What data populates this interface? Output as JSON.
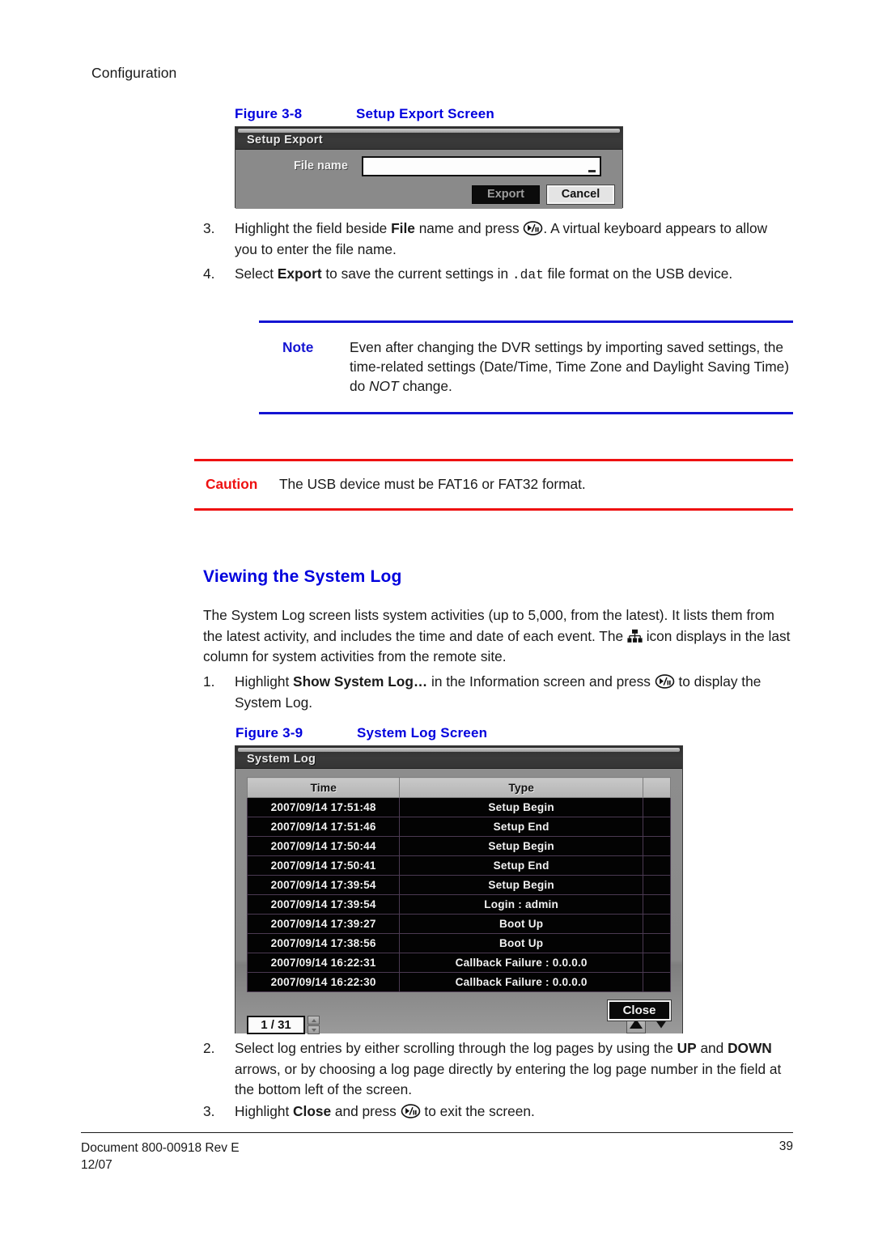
{
  "header": {
    "running_head": "Configuration"
  },
  "footer": {
    "document": "Document 800-00918 Rev E",
    "date": "12/07",
    "page_number": "39"
  },
  "figure_3_8": {
    "number": "Figure 3-8",
    "title": "Setup Export Screen",
    "dialog": {
      "titlebar": "Setup Export",
      "file_name_label": "File name",
      "file_name_value": "",
      "export_button": "Export",
      "cancel_button": "Cancel"
    }
  },
  "steps_export": [
    {
      "num": "3.",
      "parts": [
        {
          "t": "Highlight the field beside "
        },
        {
          "t": "File",
          "b": true
        },
        {
          "t": " name and press "
        },
        {
          "icon": "play-pause-key-icon"
        },
        {
          "t": ". A virtual keyboard appears to allow you to enter the file name."
        }
      ]
    },
    {
      "num": "4.",
      "parts": [
        {
          "t": "Select "
        },
        {
          "t": "Export",
          "b": true
        },
        {
          "t": " to save the current settings in "
        },
        {
          "t": ".dat",
          "mono": true
        },
        {
          "t": " file format on the USB device."
        }
      ]
    }
  ],
  "note": {
    "label": "Note",
    "parts": [
      {
        "t": "Even after changing the DVR settings by importing saved settings, the time-related settings (Date/Time, Time Zone and Daylight Saving Time) do "
      },
      {
        "t": "NOT",
        "i": true
      },
      {
        "t": " change."
      }
    ],
    "rule_color": "#1414d2"
  },
  "caution": {
    "label": "Caution",
    "text": "The USB device must be FAT16 or FAT32 format.",
    "rule_color": "#ee1111"
  },
  "section": {
    "heading": "Viewing the System Log",
    "intro_parts": [
      {
        "t": "The System Log screen lists system activities (up to 5,000, from the latest). It lists them from the latest activity, and includes the time and date of each event. The "
      },
      {
        "icon": "network-site-icon"
      },
      {
        "t": " icon displays in the last column for system activities from the remote site."
      }
    ]
  },
  "steps_log_before": [
    {
      "num": "1.",
      "parts": [
        {
          "t": "Highlight "
        },
        {
          "t": "Show System Log…",
          "b": true
        },
        {
          "t": " in the Information screen and press "
        },
        {
          "icon": "play-pause-key-icon"
        },
        {
          "t": " to display the System Log."
        }
      ]
    }
  ],
  "figure_3_9": {
    "number": "Figure 3-9",
    "title": "System Log Screen",
    "dialog": {
      "titlebar": "System Log",
      "columns": [
        "Time",
        "Type",
        ""
      ],
      "rows": [
        [
          "2007/09/14  17:51:48",
          "Setup Begin",
          ""
        ],
        [
          "2007/09/14  17:51:46",
          "Setup End",
          ""
        ],
        [
          "2007/09/14  17:50:44",
          "Setup Begin",
          ""
        ],
        [
          "2007/09/14  17:50:41",
          "Setup End",
          ""
        ],
        [
          "2007/09/14  17:39:54",
          "Setup Begin",
          ""
        ],
        [
          "2007/09/14  17:39:54",
          "Login : admin",
          ""
        ],
        [
          "2007/09/14  17:39:27",
          "Boot Up",
          ""
        ],
        [
          "2007/09/14  17:38:56",
          "Boot Up",
          ""
        ],
        [
          "2007/09/14  16:22:31",
          "Callback Failure : 0.0.0.0",
          ""
        ],
        [
          "2007/09/14  16:22:30",
          "Callback Failure : 0.0.0.0",
          ""
        ]
      ],
      "page_indicator": "1 / 31",
      "close_button": "Close"
    }
  },
  "steps_log_after": [
    {
      "num": "2.",
      "parts": [
        {
          "t": "Select log entries by either scrolling through the log pages by using the "
        },
        {
          "t": "UP",
          "b": true
        },
        {
          "t": " and "
        },
        {
          "t": "DOWN",
          "b": true
        },
        {
          "t": " arrows, or by choosing a log page directly by entering the log page number in the field at the bottom left of the screen."
        }
      ]
    },
    {
      "num": "3.",
      "parts": [
        {
          "t": "Highlight "
        },
        {
          "t": "Close",
          "b": true
        },
        {
          "t": " and press "
        },
        {
          "icon": "play-pause-key-icon"
        },
        {
          "t": " to exit the screen."
        }
      ]
    }
  ],
  "colors": {
    "heading_blue": "#0000dd",
    "note_blue": "#1414d2",
    "caution_red": "#ee1111",
    "dialog_gray": "#8a8a8a",
    "log_row_bg": "#030303"
  }
}
